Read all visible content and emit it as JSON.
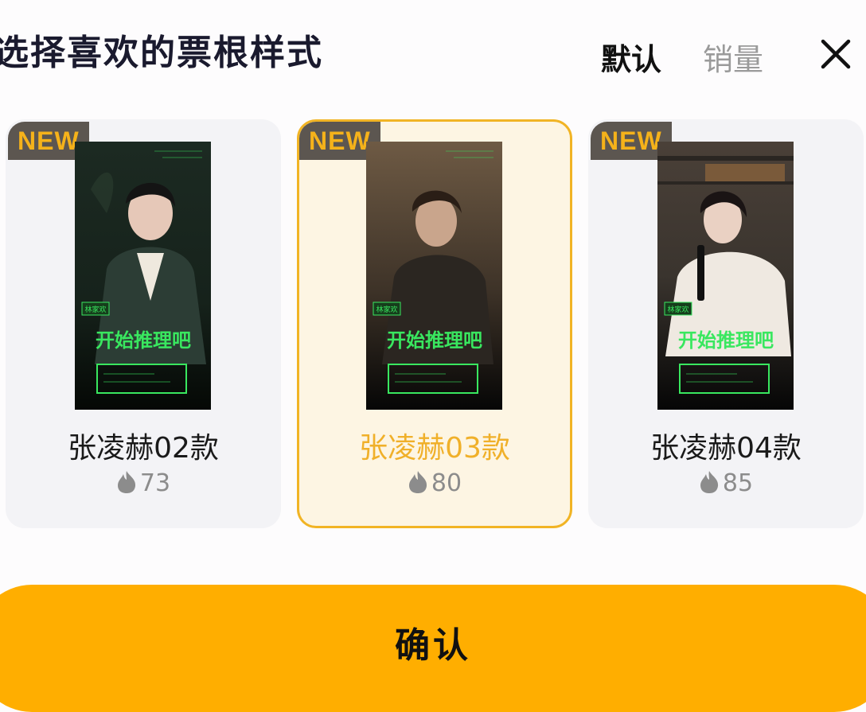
{
  "header": {
    "title": "选择喜欢的票根样式",
    "sort_default": "默认",
    "sort_sales": "销量"
  },
  "icons": {
    "close": "close-icon",
    "heat": "flame-icon"
  },
  "cards": [
    {
      "name": "张凌赫02款",
      "heat": "73",
      "badge": "NEW",
      "selected": false,
      "poster": {
        "tag": "林家欢",
        "slogan": "开始推理吧",
        "icon": "person-photo"
      }
    },
    {
      "name": "张凌赫03款",
      "heat": "80",
      "badge": "NEW",
      "selected": true,
      "poster": {
        "tag": "林家欢",
        "slogan": "开始推理吧",
        "icon": "person-photo"
      }
    },
    {
      "name": "张凌赫04款",
      "heat": "85",
      "badge": "NEW",
      "selected": false,
      "poster": {
        "tag": "林家欢",
        "slogan": "开始推理吧",
        "icon": "person-photo"
      }
    }
  ],
  "footer": {
    "confirm_label": "确认"
  },
  "colors": {
    "accent": "#ffae00",
    "selected_text": "#f0b02a",
    "badge_text": "#f5b21a",
    "poster_green": "#39e75f"
  }
}
